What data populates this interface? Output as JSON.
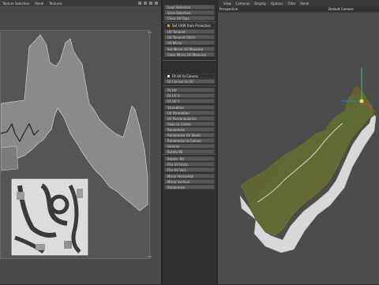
{
  "uv_editor": {
    "menu": [
      "Texture Selection",
      "Panel",
      "Textures"
    ],
    "ruler_top_right": "1.0",
    "ruler_bottom_right": "1.0"
  },
  "command_panel": {
    "items": [
      {
        "label": "Load Selection",
        "highlight": false
      },
      {
        "label": "Save Selection",
        "highlight": false
      },
      {
        "label": "Clear UV Tags",
        "highlight": false
      },
      {
        "label": "Set UVW from Projection",
        "highlight": true,
        "icon": "star"
      },
      {
        "label": "UV Tangent",
        "highlight": false
      },
      {
        "label": "UV Tangent Stitch",
        "highlight": false
      },
      {
        "label": "UV Mirror",
        "highlight": false
      },
      {
        "label": "Set Mirror UV Mapping",
        "highlight": false
      },
      {
        "label": "Clear Mirror UV Mapping",
        "highlight": false
      },
      {
        "label": "Fit UV to Canvas",
        "highlight": true,
        "icon": "x"
      },
      {
        "label": "Fit Canvas to UV",
        "highlight": false
      },
      {
        "label": "Fit UV",
        "highlight": false
      },
      {
        "label": "Fit UV X",
        "highlight": false
      },
      {
        "label": "Fit UV Y",
        "highlight": false
      },
      {
        "label": "Straighten",
        "highlight": false
      },
      {
        "label": "UV Straighten",
        "highlight": false
      },
      {
        "label": "UV Rectangularize",
        "highlight": false
      },
      {
        "label": "Align to Center",
        "highlight": false
      },
      {
        "label": "Randomize",
        "highlight": false
      },
      {
        "label": "Randomize UV Shells",
        "highlight": false
      },
      {
        "label": "Randomize to Canvas",
        "highlight": false
      },
      {
        "label": "Unwrap",
        "highlight": false
      },
      {
        "label": "Rotate 90",
        "highlight": false
      },
      {
        "label": "Rotate -90",
        "highlight": false
      },
      {
        "label": "Flip UV Horiz.",
        "highlight": false
      },
      {
        "label": "Flip UV Vert.",
        "highlight": false
      },
      {
        "label": "Mirror Horizontal",
        "highlight": false
      },
      {
        "label": "Mirror Vertical",
        "highlight": false
      },
      {
        "label": "Randomize",
        "highlight": false
      }
    ]
  },
  "viewport": {
    "menu": [
      "View",
      "Cameras",
      "Display",
      "Options",
      "Filter",
      "Panel"
    ],
    "mode_label": "Perspective",
    "camera_label": "Default Camera"
  }
}
